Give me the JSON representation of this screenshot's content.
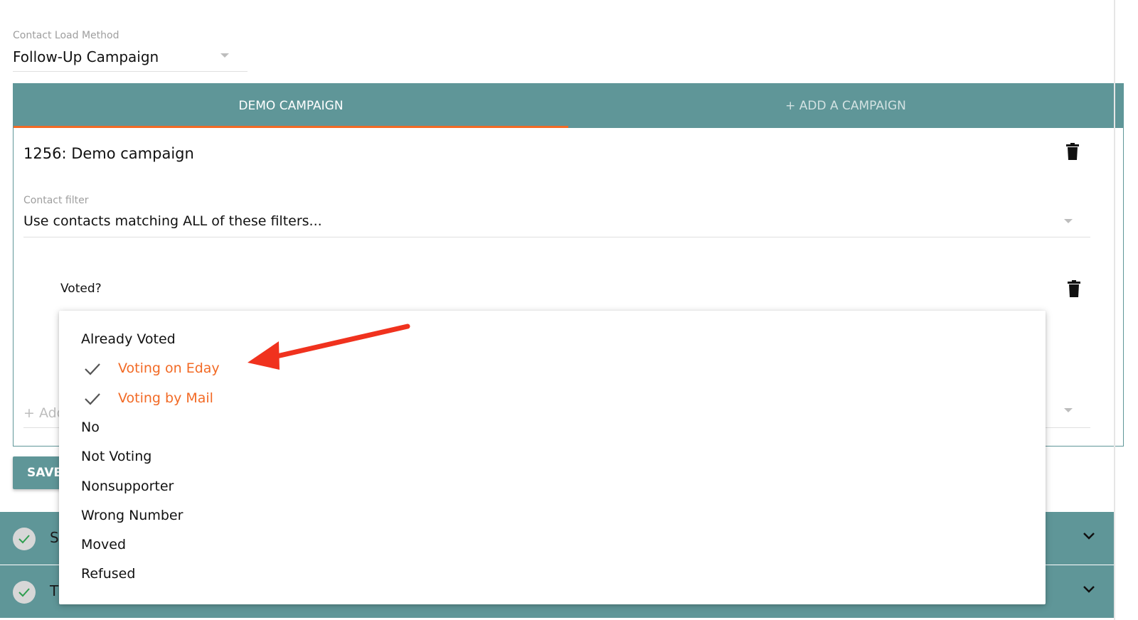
{
  "load_method": {
    "label": "Contact Load Method",
    "value": "Follow-Up Campaign"
  },
  "tabs": [
    {
      "label": "DEMO CAMPAIGN",
      "active": true
    },
    {
      "label": "+ ADD A CAMPAIGN",
      "active": false
    }
  ],
  "campaign": {
    "title": "1256: Demo campaign",
    "filter_label": "Contact filter",
    "filter_value": "Use contacts matching ALL of these filters...",
    "filter_item_label": "Voted?",
    "add_filter_label": "+ Add"
  },
  "save_label": "SAVE",
  "accordions": [
    {
      "title": "S",
      "complete": true
    },
    {
      "title": "T",
      "complete": true
    }
  ],
  "dropdown": {
    "options": [
      {
        "label": "Already Voted",
        "selected": false
      },
      {
        "label": "Voting on Eday",
        "selected": true
      },
      {
        "label": "Voting by Mail",
        "selected": true
      },
      {
        "label": "No",
        "selected": false
      },
      {
        "label": "Not Voting",
        "selected": false
      },
      {
        "label": "Nonsupporter",
        "selected": false
      },
      {
        "label": "Wrong Number",
        "selected": false
      },
      {
        "label": "Moved",
        "selected": false
      },
      {
        "label": "Refused",
        "selected": false
      }
    ]
  },
  "colors": {
    "teal": "#5f9698",
    "accent": "#f26a25",
    "annotation": "#f0321e"
  }
}
